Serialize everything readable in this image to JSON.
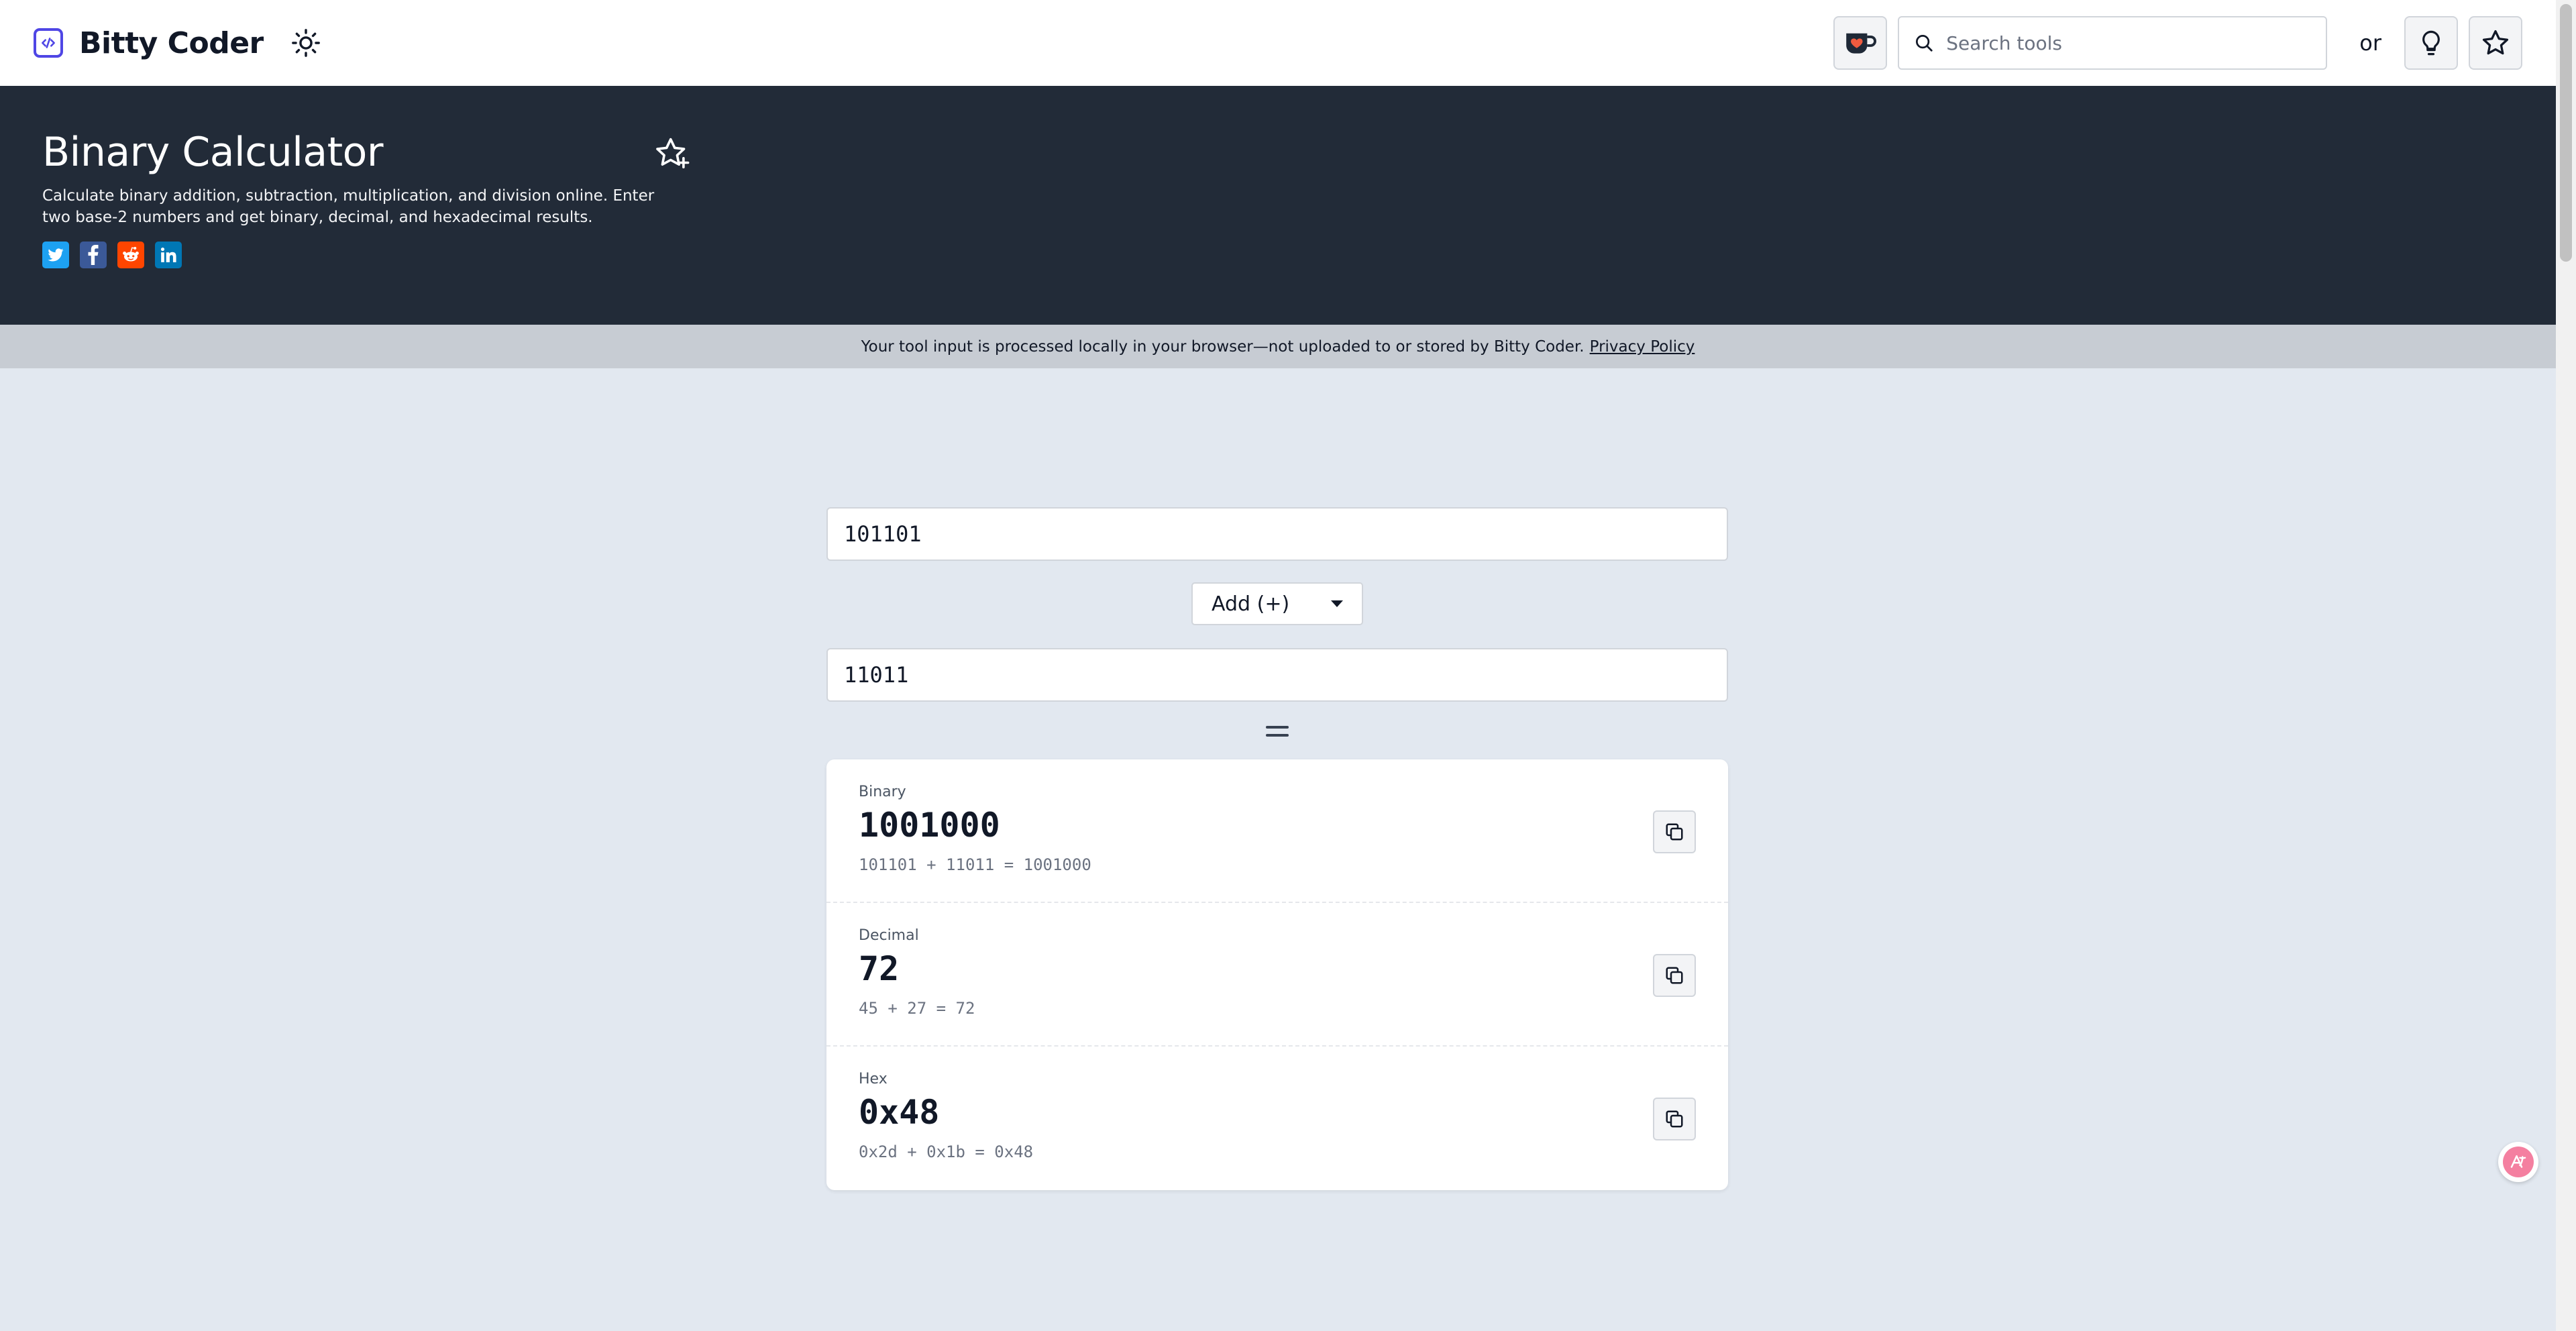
{
  "header": {
    "brand": "Bitty Coder",
    "search_placeholder": "Search tools",
    "or_label": "or"
  },
  "hero": {
    "title": "Binary Calculator",
    "description": "Calculate binary addition, subtraction, multiplication, and division online. Enter two base-2 numbers and get binary, decimal, and hexadecimal results."
  },
  "share": [
    {
      "name": "twitter",
      "color": "#1da1f2"
    },
    {
      "name": "facebook",
      "color": "#3b5998"
    },
    {
      "name": "reddit",
      "color": "#ff4500"
    },
    {
      "name": "linkedin",
      "color": "#0077b5"
    }
  ],
  "privacy": {
    "text": "Your tool input is processed locally in your browser—not uploaded to or stored by Bitty Coder.",
    "link": "Privacy Policy"
  },
  "calculator": {
    "input_a": "101101",
    "operation": "Add (+)",
    "input_b": "11011",
    "results": [
      {
        "label": "Binary",
        "value": "1001000",
        "expression": "101101 + 11011 = 1001000"
      },
      {
        "label": "Decimal",
        "value": "72",
        "expression": "45 + 27 = 72"
      },
      {
        "label": "Hex",
        "value": "0x48",
        "expression": "0x2d + 0x1b = 0x48"
      }
    ]
  }
}
